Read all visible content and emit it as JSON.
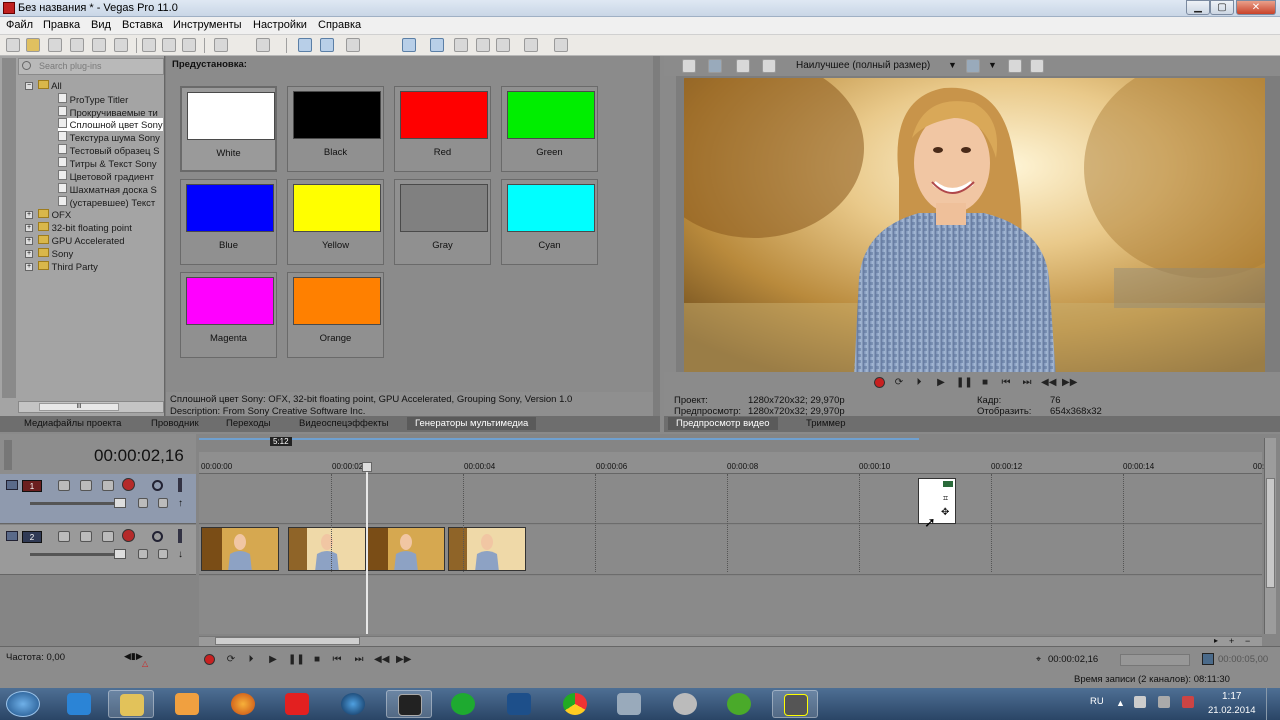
{
  "window": {
    "title": "Без названия * - Vegas Pro 11.0",
    "min": "▁",
    "max": "▢",
    "close": "✕"
  },
  "menu": [
    "Файл",
    "Правка",
    "Вид",
    "Вставка",
    "Инструменты",
    "Настройки",
    "Справка"
  ],
  "plugins": {
    "search_placeholder": "Search plug-ins",
    "root": "All",
    "items": [
      "ProType Titler",
      "Прокручиваемые ти",
      "Сплошной цвет Sony",
      "Текстура шума Sony",
      "Тестовый образец S",
      "Титры & Текст Sony",
      "Цветовой градиент",
      "Шахматная доска S",
      "(устаревшее) Текст"
    ],
    "groups": [
      "OFX",
      "32-bit floating point",
      "GPU Accelerated",
      "Sony",
      "Third Party"
    ],
    "scroll_grip": "III"
  },
  "presets": {
    "heading": "Предустановка:",
    "swatches": [
      {
        "label": "White",
        "color": "#ffffff"
      },
      {
        "label": "Black",
        "color": "#000000"
      },
      {
        "label": "Red",
        "color": "#ff0000"
      },
      {
        "label": "Green",
        "color": "#00ee00"
      },
      {
        "label": "Blue",
        "color": "#0000ff"
      },
      {
        "label": "Yellow",
        "color": "#ffff00"
      },
      {
        "label": "Gray",
        "color": "#808080"
      },
      {
        "label": "Cyan",
        "color": "#00ffff"
      },
      {
        "label": "Magenta",
        "color": "#ff00ff"
      },
      {
        "label": "Orange",
        "color": "#ff8000"
      }
    ],
    "desc1": "Сплошной цвет Sony: OFX, 32-bit floating point, GPU Accelerated, Grouping Sony, Version 1.0",
    "desc2": "Description: From Sony Creative Software Inc."
  },
  "left_tabs": [
    "Медиафайлы проекта",
    "Проводник",
    "Переходы",
    "Видеоспецэффекты",
    "Генераторы мультимедиа"
  ],
  "preview": {
    "quality": "Наилучшее (полный размер)",
    "project_label": "Проект:",
    "project_value": "1280x720x32; 29,970p",
    "preview_label": "Предпросмотр:",
    "preview_value": "1280x720x32; 29,970p",
    "frame_label": "Кадр:",
    "frame_value": "76",
    "display_label": "Отобразить:",
    "display_value": "654x368x32"
  },
  "right_tabs": [
    "Предпросмотр видео",
    "Триммер"
  ],
  "timeline": {
    "timecode": "00:00:02,16",
    "loop_marker": "5:12",
    "ticks": [
      "00:00:00",
      "00:00:02",
      "00:00:04",
      "00:00:06",
      "00:00:08",
      "00:00:10",
      "00:00:12",
      "00:00:14",
      "00:"
    ],
    "tracks": [
      {
        "num": "1"
      },
      {
        "num": "2"
      }
    ]
  },
  "transport": {
    "rate_label": "Частота: 0,00",
    "time": "00:00:02,16",
    "end_time": "00:00:05,00"
  },
  "status": {
    "record_time": "Время записи (2 каналов): 08:11:30"
  },
  "taskbar": {
    "lang": "RU",
    "clock": "1:17",
    "date": "21.02.2014"
  },
  "colors": {
    "accent": "#5b7fa6",
    "taskbar": "#2a4566"
  }
}
